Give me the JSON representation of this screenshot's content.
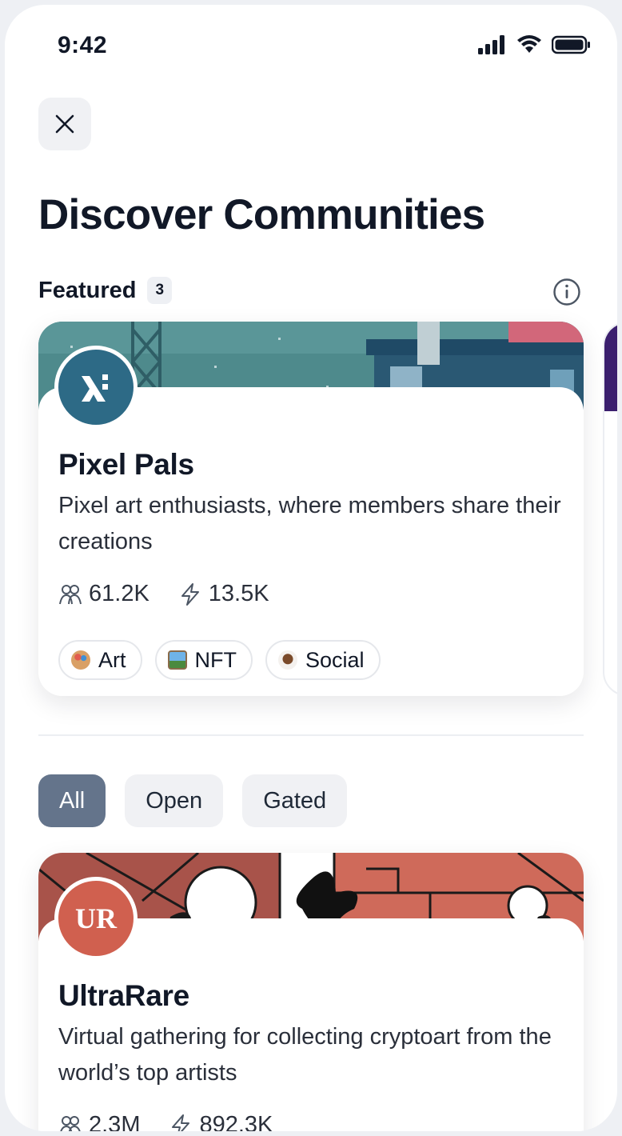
{
  "status_bar": {
    "time": "9:42"
  },
  "header": {
    "title": "Discover Communities"
  },
  "featured": {
    "label": "Featured",
    "count": "3",
    "card": {
      "avatar_text": "ẋ",
      "name": "Pixel Pals",
      "description": "Pixel art enthusiasts, where members share their creations",
      "members": "61.2K",
      "activity": "13.5K",
      "tags": [
        {
          "label": "Art",
          "icon": "palette-icon",
          "color": "#c98a5a"
        },
        {
          "label": "NFT",
          "icon": "picture-icon",
          "color": "#4a78a8"
        },
        {
          "label": "Social",
          "icon": "coffee-icon",
          "color": "#8a5a3a"
        }
      ],
      "accent": "#2d6a86"
    }
  },
  "filters": [
    {
      "label": "All",
      "active": true
    },
    {
      "label": "Open",
      "active": false
    },
    {
      "label": "Gated",
      "active": false
    }
  ],
  "list": [
    {
      "avatar_text": "UR",
      "name": "UltraRare",
      "description": "Virtual gathering for collecting cryptoart from the world’s top artists",
      "members": "2.3M",
      "activity": "892.3K",
      "accent": "#d0604f"
    }
  ]
}
